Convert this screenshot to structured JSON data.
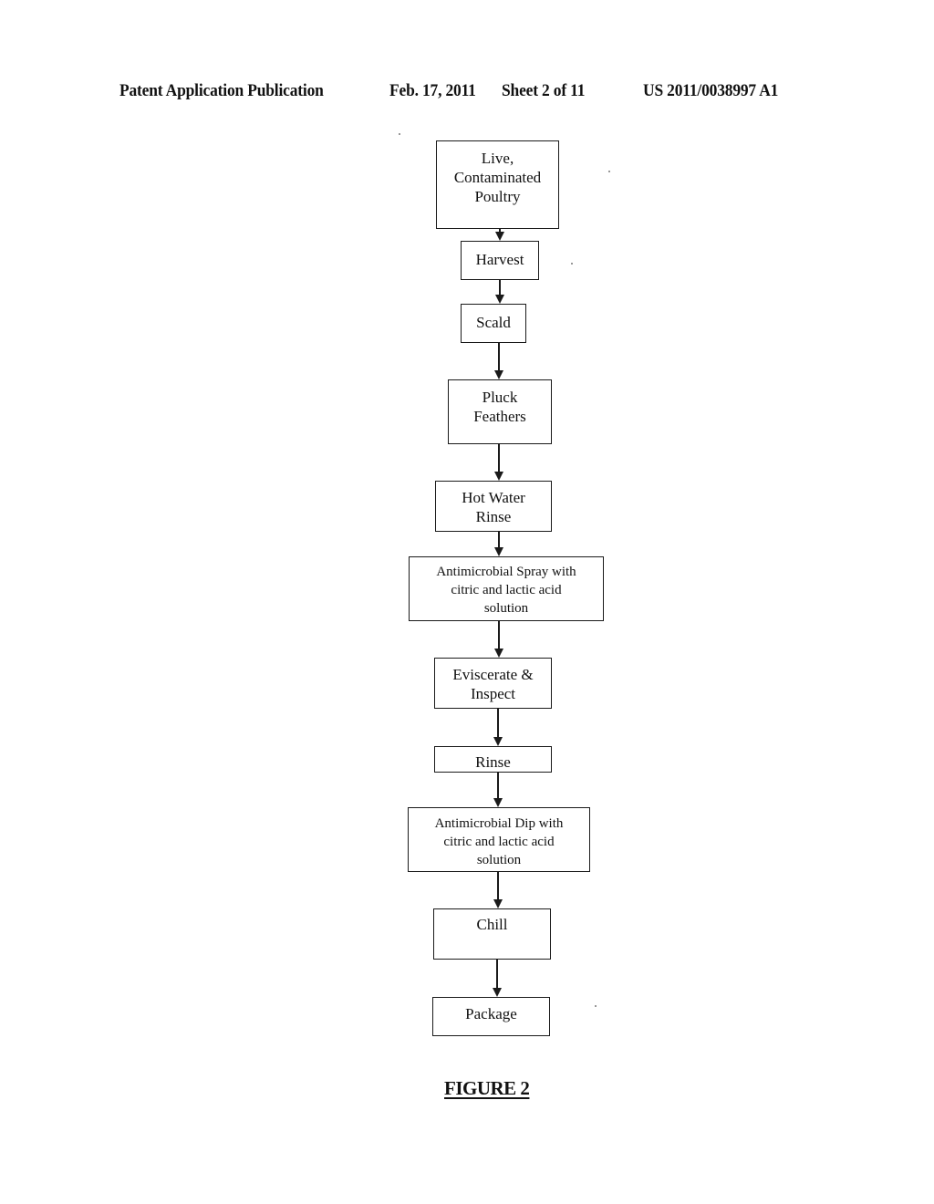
{
  "header": {
    "publication": "Patent Application Publication",
    "date": "Feb. 17, 2011",
    "sheet": "Sheet 2 of 11",
    "number": "US 2011/0038997 A1"
  },
  "flowchart": {
    "steps": [
      {
        "lines": [
          "Live,",
          "Contaminated",
          "Poultry"
        ]
      },
      {
        "lines": [
          "Harvest"
        ]
      },
      {
        "lines": [
          "Scald"
        ]
      },
      {
        "lines": [
          "Pluck",
          "Feathers"
        ]
      },
      {
        "lines": [
          "Hot Water",
          "Rinse"
        ]
      },
      {
        "lines": [
          "Antimicrobial Spray with",
          "citric and lactic acid",
          "solution"
        ]
      },
      {
        "lines": [
          "Eviscerate &",
          "Inspect"
        ]
      },
      {
        "lines": [
          "Rinse"
        ]
      },
      {
        "lines": [
          "Antimicrobial Dip with",
          "citric and lactic acid",
          "solution"
        ]
      },
      {
        "lines": [
          "Chill"
        ]
      },
      {
        "lines": [
          "Package"
        ]
      }
    ]
  },
  "figure": {
    "caption": "FIGURE 2"
  }
}
